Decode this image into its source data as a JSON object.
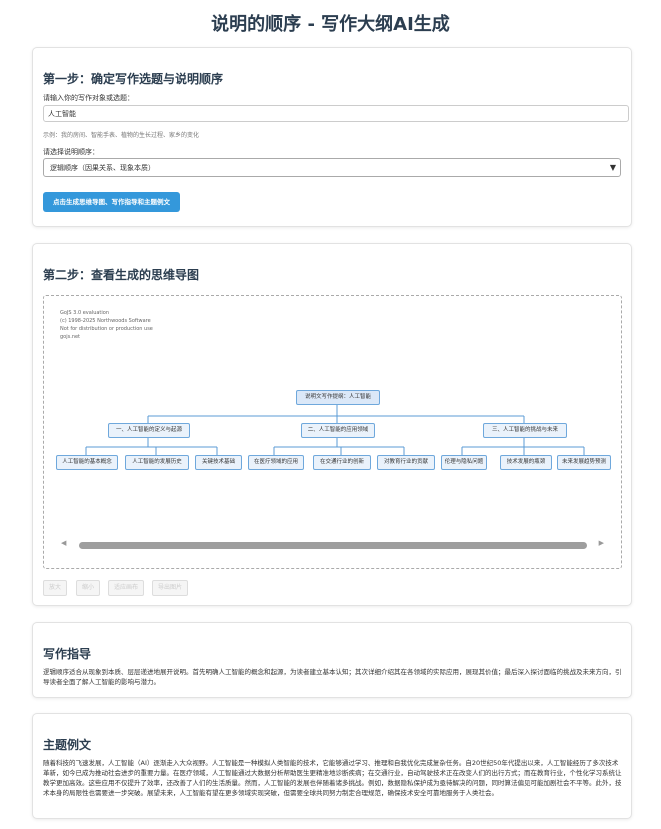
{
  "page": {
    "title": "说明的顺序 - 写作大纲AI生成"
  },
  "step1": {
    "heading": "第一步：确定写作选题与说明顺序",
    "topic_label": "请输入你的写作对象或选题：",
    "topic_value": "人工智能",
    "topic_hint": "示例：我的房间、智能手表、植物的生长过程、家乡的变化",
    "order_label": "请选择说明顺序：",
    "order_selected": "逻辑顺序（因果关系、现象本质）",
    "generate_button": "点击生成思维导图、写作指导和主题例文"
  },
  "step2": {
    "heading": "第二步：查看生成的思维导图",
    "watermark": [
      "GoJS 3.0 evaluation",
      "(c) 1998-2025 Northwoods Software",
      "Not for distribution or production use",
      "gojs.net"
    ],
    "mindmap": {
      "root": "说明文写作提纲：人工智能",
      "branches": [
        {
          "label": "一、人工智能的定义与起源",
          "children": [
            "人工智能的基本概念",
            "人工智能的发展历史",
            "关键技术基础"
          ]
        },
        {
          "label": "二、人工智能的应用领域",
          "children": [
            "在医疗领域的应用",
            "在交通行业的创新",
            "对教育行业的贡献"
          ]
        },
        {
          "label": "三、人工智能的挑战与未来",
          "children": [
            "伦理与隐私问题",
            "技术发展的瓶颈",
            "未来发展趋势预测"
          ]
        }
      ]
    },
    "buttons": [
      "放大",
      "缩小",
      "适应画布",
      "导出图片"
    ]
  },
  "guide": {
    "heading": "写作指导",
    "text": "逻辑顺序适合从现象到本质、层层递进地展开说明。首先明确人工智能的概念和起源，为读者建立基本认知；其次详细介绍其在各领域的实际应用，展现其价值；最后深入探讨面临的挑战及未来方向，引导读者全面了解人工智能的影响与潜力。"
  },
  "example": {
    "heading": "主题例文",
    "text": "随着科技的飞速发展，人工智能（AI）逐渐走入大众视野。人工智能是一种模拟人类智能的技术，它能够通过学习、推理和自我优化完成复杂任务。自20世纪50年代提出以来，人工智能经历了多次技术革新，如今已成为推动社会进步的重要力量。在医疗领域，人工智能通过大数据分析帮助医生更精准地诊断疾病；在交通行业，自动驾驶技术正在改变人们的出行方式；而在教育行业，个性化学习系统让教学更加高效。这些应用不仅提升了效率，还改善了人们的生活质量。然而，人工智能的发展也伴随着诸多挑战。例如，数据隐私保护成为亟待解决的问题，同时算法偏见可能加剧社会不平等。此外，技术本身的局限性也需要进一步突破。展望未来，人工智能有望在更多领域实现突破，但需要全球共同努力制定合理规范，确保技术安全可靠地服务于人类社会。"
  }
}
